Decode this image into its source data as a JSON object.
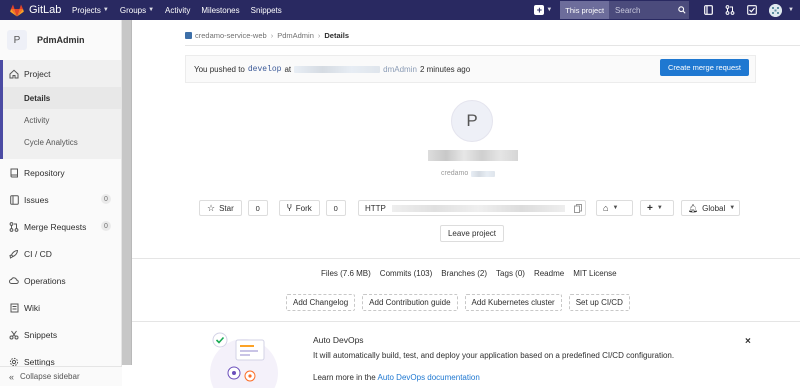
{
  "navbar": {
    "brand": "GitLab",
    "menu": [
      {
        "label": "Projects",
        "caret": true
      },
      {
        "label": "Groups",
        "caret": true
      },
      {
        "label": "Activity",
        "caret": false
      },
      {
        "label": "Milestones",
        "caret": false
      },
      {
        "label": "Snippets",
        "caret": false
      }
    ],
    "search_scope": "This project",
    "search_placeholder": "Search",
    "bg_color": "#292961"
  },
  "sidebar": {
    "project_initial": "P",
    "project_name": "PdmAdmin",
    "project_label": "Project",
    "subitems": [
      "Details",
      "Activity",
      "Cycle Analytics"
    ],
    "items": [
      {
        "label": "Repository",
        "icon": "book-icon"
      },
      {
        "label": "Issues",
        "icon": "issues-icon",
        "badge": "0"
      },
      {
        "label": "Merge Requests",
        "icon": "merge-request-icon",
        "badge": "0"
      },
      {
        "label": "CI / CD",
        "icon": "rocket-icon"
      },
      {
        "label": "Operations",
        "icon": "cloud-gear-icon"
      },
      {
        "label": "Wiki",
        "icon": "wiki-icon"
      },
      {
        "label": "Snippets",
        "icon": "scissors-icon"
      },
      {
        "label": "Settings",
        "icon": "settings-icon"
      }
    ],
    "collapse_label": "Collapse sidebar"
  },
  "breadcrumb": [
    "credamo-service-web",
    "PdmAdmin",
    "Details"
  ],
  "flash": {
    "prefix": "You pushed to",
    "branch": "develop",
    "at": "at",
    "project_suffix": "dmAdmin",
    "time": "2 minutes ago",
    "button": "Create merge request"
  },
  "project": {
    "initial": "P",
    "namespace_fragment": "credamo"
  },
  "actions": {
    "star_label": "Star",
    "star_count": "0",
    "fork_label": "Fork",
    "fork_count": "0",
    "clone_protocol": "HTTP",
    "notification_label": "Global",
    "leave_label": "Leave project"
  },
  "stats": [
    "Files (7.6 MB)",
    "Commits (103)",
    "Branches (2)",
    "Tags (0)",
    "Readme",
    "MIT License"
  ],
  "ctas": [
    "Add Changelog",
    "Add Contribution guide",
    "Add Kubernetes cluster",
    "Set up CI/CD"
  ],
  "devops": {
    "title": "Auto DevOps",
    "description": "It will automatically build, test, and deploy your application based on a predefined CI/CD configuration.",
    "learn_prefix": "Learn more in the",
    "learn_link": "Auto DevOps documentation",
    "close": "×"
  }
}
